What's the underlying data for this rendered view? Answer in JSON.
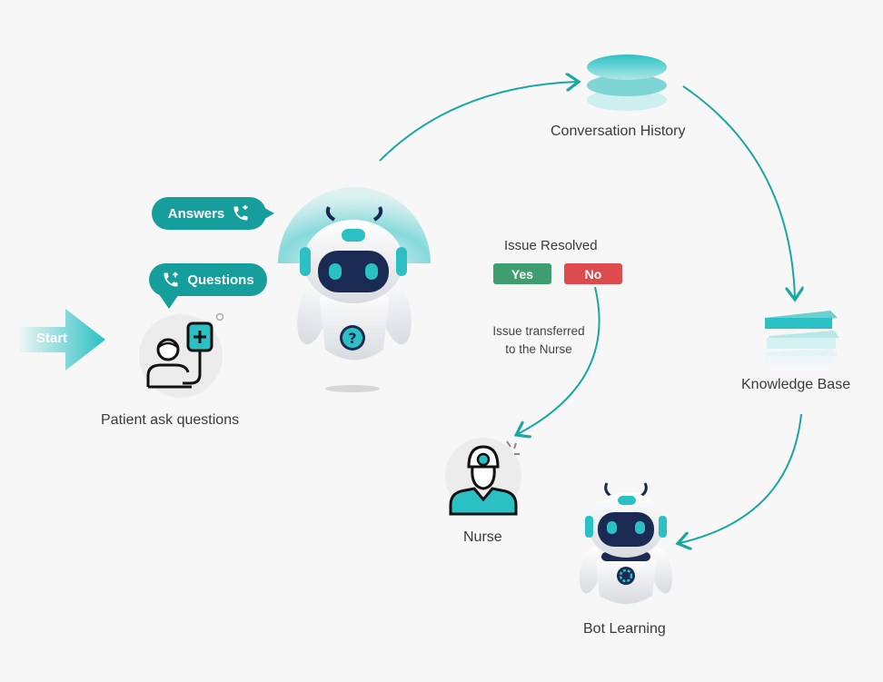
{
  "colors": {
    "teal": "#159e9b",
    "teal_light": "#2bc1c4",
    "yes_green": "#3f9e6f",
    "no_red": "#dd4b4f",
    "arrow": "#1aa7a3",
    "text": "#3a3a3a",
    "background": "#f7f7f7"
  },
  "start": {
    "label": "Start"
  },
  "bubbles": {
    "answers": {
      "label": "Answers",
      "icon": "phone-icon"
    },
    "questions": {
      "label": "Questions",
      "icon": "phone-icon"
    }
  },
  "patient": {
    "label": "Patient ask questions",
    "icon": "patient-iv-drip-icon"
  },
  "conversation_history": {
    "label": "Conversation History",
    "icon": "database-icon"
  },
  "knowledge_base": {
    "label": "Knowledge Base",
    "icon": "books-icon"
  },
  "issue_resolved": {
    "label": "Issue Resolved",
    "yes": "Yes",
    "no": "No"
  },
  "transfer": {
    "line1": "Issue transferred",
    "line2": "to the Nurse"
  },
  "nurse": {
    "label": "Nurse",
    "icon": "nurse-icon"
  },
  "bot_learning": {
    "label": "Bot Learning",
    "icon": "robot-gear-icon"
  },
  "main_bot": {
    "icon": "robot-question-icon",
    "badge": "?"
  }
}
